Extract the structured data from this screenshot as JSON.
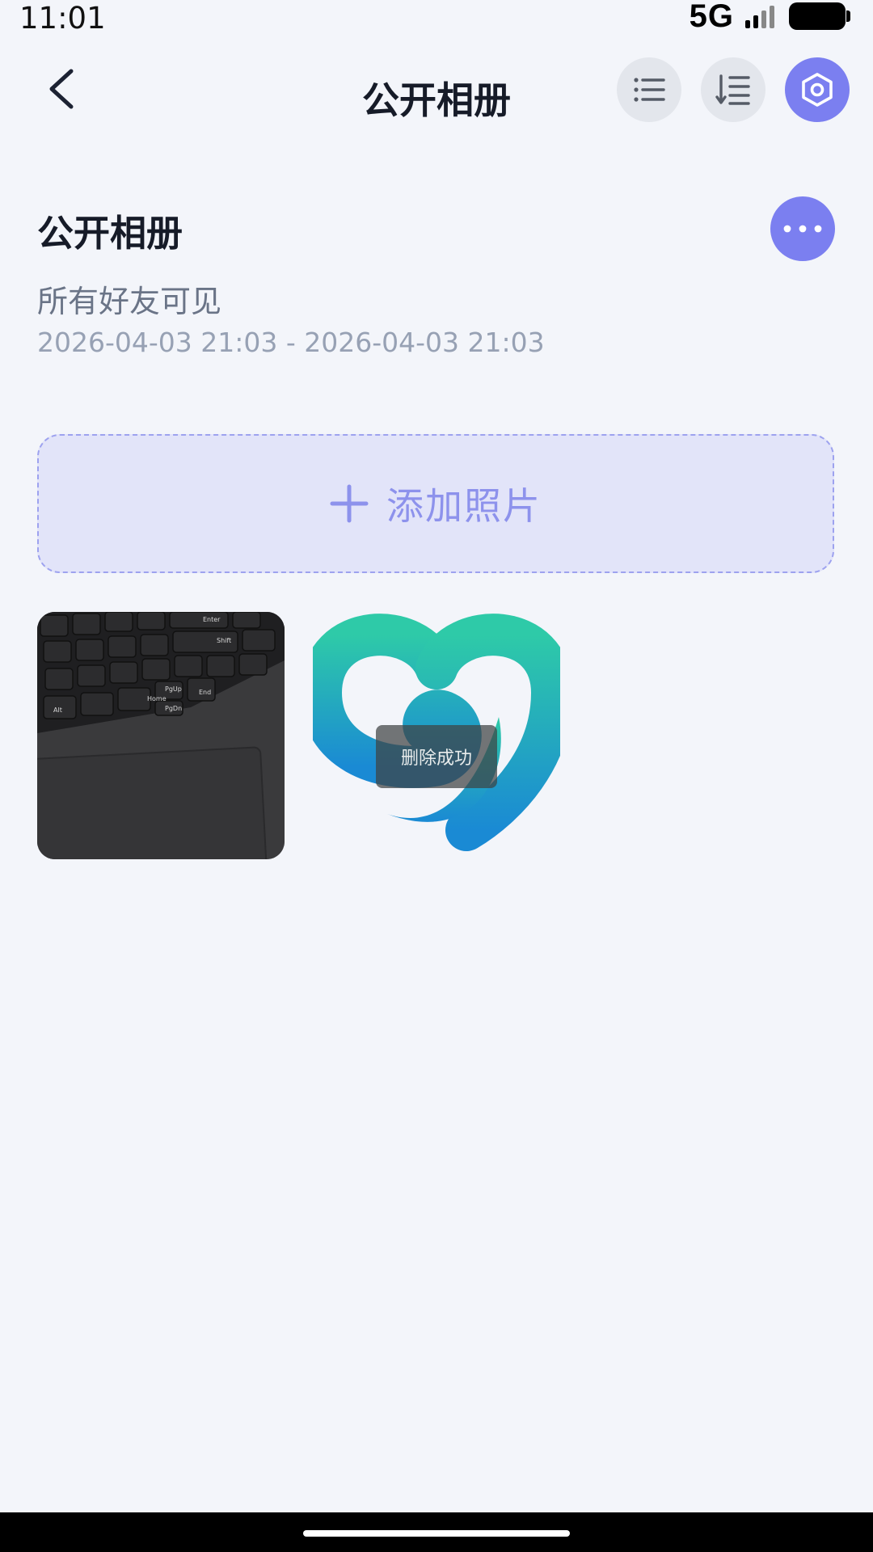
{
  "status_bar": {
    "time": "11:01",
    "network": "5G"
  },
  "header": {
    "title": "公开相册",
    "back_icon": "chevron-left-icon",
    "list_icon": "list-icon",
    "sort_icon": "sort-order-icon",
    "settings_icon": "hexagon-settings-icon"
  },
  "album": {
    "name": "公开相册",
    "visibility": "所有好友可见",
    "date_range": "2026-04-03 21:03 - 2026-04-03 21:03"
  },
  "add_photo": {
    "label": "添加照片",
    "icon": "plus-icon"
  },
  "photos": [
    {
      "subject": "laptop keyboard and touchpad",
      "keys": [
        "Enter",
        "Shift",
        "PgUp",
        "PgDn",
        "Home",
        "End",
        "Alt"
      ]
    },
    {
      "subject": "teal heart logo"
    }
  ],
  "toast": {
    "text": "删除成功"
  },
  "colors": {
    "accent": "#7b7ff0",
    "background": "#f3f5fa",
    "add_photo_bg": "#e2e4f9",
    "logo_teal": "#2ecaa8",
    "logo_blue": "#1a8ad4"
  }
}
